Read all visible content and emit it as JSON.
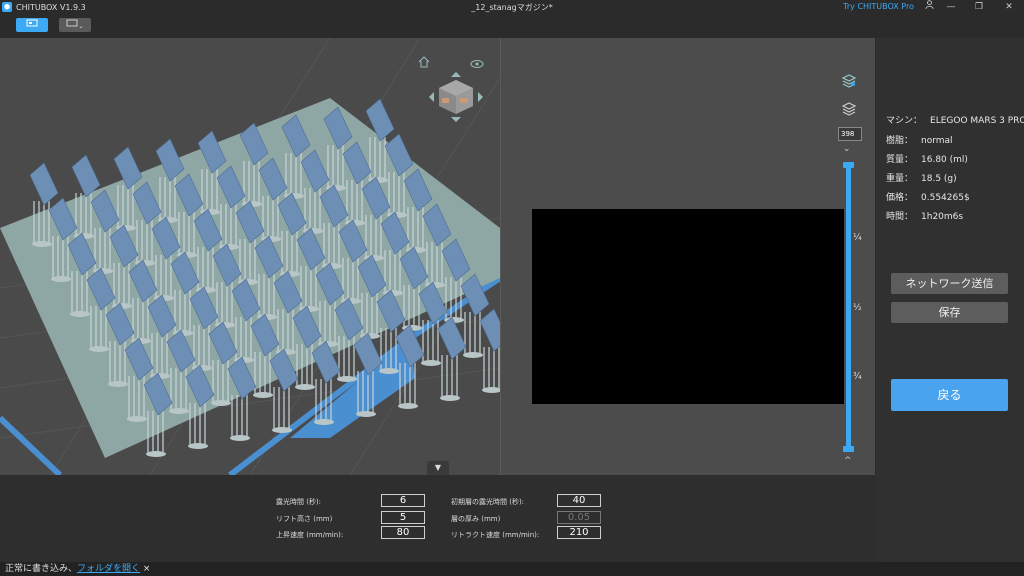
{
  "titlebar": {
    "app_name": "CHITUBOX V1.9.3",
    "doc_title": "_12_stanagマガジン*",
    "try_pro": "Try CHITUBOX Pro"
  },
  "preview": {
    "layer_value": "398",
    "fractions": [
      "¼",
      "½",
      "¾"
    ]
  },
  "info": {
    "machine_label": "マシン：",
    "machine_value": "ELEGOO MARS 3 PRO",
    "resin_label": "樹脂：",
    "resin_value": "normal",
    "volume_label": "質量：",
    "volume_value": "16.80  (ml)",
    "weight_label": "重量：",
    "weight_value": "18.5  (g)",
    "price_label": "価格：",
    "price_value": "0.554265$",
    "time_label": "時間：",
    "time_value": "1h20m6s"
  },
  "actions": {
    "network_send": "ネットワーク送信",
    "save": "保存",
    "back": "戻る"
  },
  "params": {
    "exposure_label": "露光時間 (秒):",
    "exposure_value": "6",
    "bottom_exposure_label": "初期層の露光時間 (秒):",
    "bottom_exposure_value": "40",
    "lift_height_label": "リフト高さ (mm)",
    "lift_height_value": "5",
    "layer_thickness_label": "層の厚み (mm)",
    "layer_thickness_value": "0.05",
    "lift_speed_label": "上昇速度 (mm/min):",
    "lift_speed_value": "80",
    "retract_speed_label": "リトラクト速度 (mm/min):",
    "retract_speed_value": "210"
  },
  "status": {
    "message": "正常に書き込み、",
    "link": "フォルダを開く",
    "close": "×"
  },
  "icons": {
    "app": "chitubox-logo-icon",
    "user": "user-icon",
    "minimize": "minimize-icon",
    "restore": "restore-icon",
    "close": "close-icon",
    "home": "home-icon",
    "eye": "eye-icon",
    "view_cube": "view-cube-icon",
    "layers": "layers-icon",
    "layers_hide": "layers-hidden-icon",
    "chevron_down": "chevron-down-icon",
    "chevron_up": "chevron-up-icon"
  },
  "colors": {
    "accent": "#3da9f5",
    "plate": "#8fa7a4",
    "part": "#6e8fb5"
  }
}
